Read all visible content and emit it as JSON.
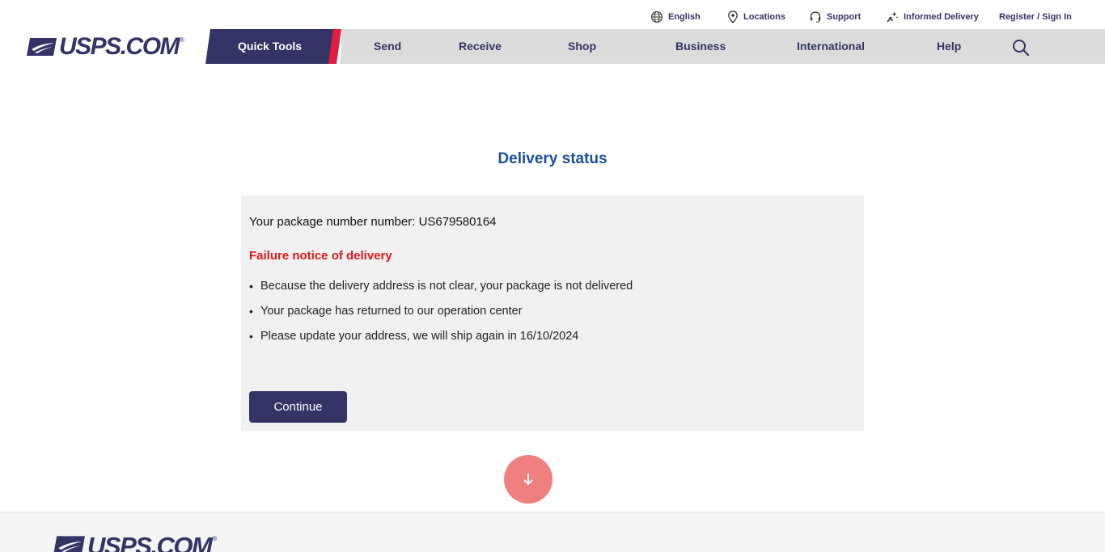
{
  "utility": {
    "language": "English",
    "locations": "Locations",
    "support": "Support",
    "informed_delivery": "Informed Delivery",
    "register": "Register / Sign In"
  },
  "logo": {
    "text": "USPS.COM",
    "reg": "®"
  },
  "nav": {
    "quick_tools": "Quick Tools",
    "items": [
      "Send",
      "Receive",
      "Shop",
      "Business",
      "International",
      "Help"
    ]
  },
  "main": {
    "title": "Delivery status",
    "package_line": "Your package number number: US679580164",
    "failure": "Failure notice of delivery",
    "bullets": [
      "Because the delivery address is not clear, your package is not delivered",
      "Your package has returned to our operation center",
      "Please update your address, we will ship again in 16/10/2024"
    ],
    "continue_label": "Continue"
  },
  "footer": {
    "logo_text": "USPS.COM",
    "reg": "®"
  },
  "colors": {
    "brand_navy": "#333366",
    "title_blue": "#1a4f9c",
    "failure_red": "#e0161b",
    "accent_red": "#e31c3d",
    "scroll_button": "#f08080"
  },
  "icons": {
    "language": "globe-icon",
    "locations": "location-pin-icon",
    "support": "headset-icon",
    "informed_delivery": "informed-delivery-icon",
    "search": "search-icon",
    "scroll": "arrow-down-icon",
    "logo": "eagle-logo-icon"
  }
}
